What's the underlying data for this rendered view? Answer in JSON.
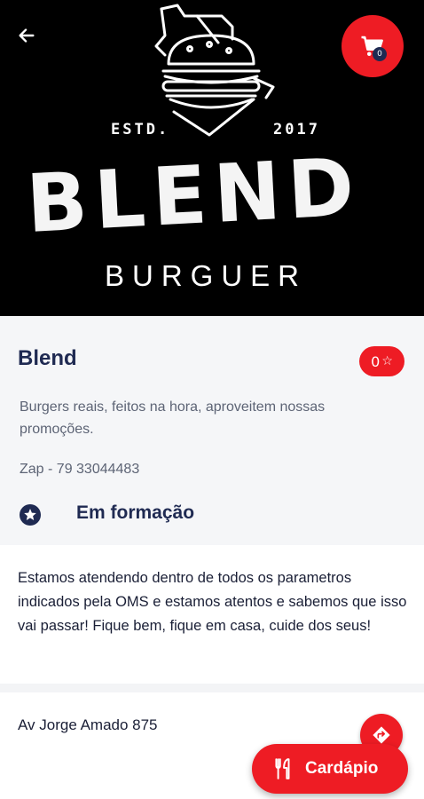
{
  "banner": {
    "estd_label": "ESTD.",
    "year": "2017",
    "brand_name": "BLEND",
    "brand_subtitle": "BURGUER"
  },
  "cart": {
    "count": "0",
    "icon": "cart-icon"
  },
  "store": {
    "name": "Blend",
    "rating": "0",
    "description": "Burgers reais, feitos na hora, aproveitem nossas promoções.",
    "contact": "Zap - 79 33044483",
    "status": "Em formação"
  },
  "notice": {
    "text": "Estamos atendendo dentro de todos os parametros indicados pela OMS e estamos atentos e sabemos que isso vai passar! Fique bem, fique em casa, cuide dos seus!"
  },
  "address": {
    "text": "Av Jorge Amado 875"
  },
  "menu_button": {
    "label": "Cardápio"
  },
  "colors": {
    "accent": "#ee1c24",
    "navy": "#1f2a52",
    "banner_bg": "#000000"
  }
}
